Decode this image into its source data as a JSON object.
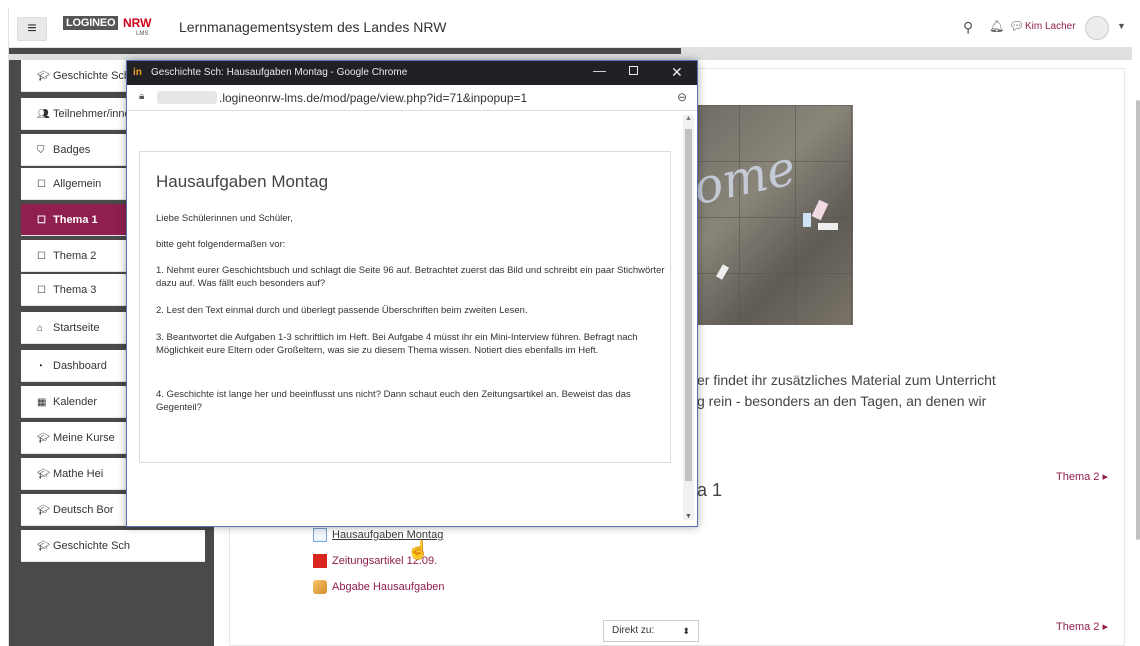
{
  "header": {
    "menu_icon": "menu-icon",
    "logo_part1": "LOGINEO",
    "logo_part2": "NRW",
    "logo_sub": "LMS",
    "site_title": "Lernmanagementsystem des Landes NRW",
    "user_name": "Kim Lacher",
    "accent_color": "#8e1f4e"
  },
  "sidebar": {
    "items": [
      {
        "label": "Geschichte Sch",
        "icon": "graduation-cap-icon"
      },
      {
        "label": "Teilnehmer/innen",
        "icon": "users-icon"
      },
      {
        "label": "Badges",
        "icon": "shield-icon"
      },
      {
        "label": "Allgemein",
        "icon": "folder-icon"
      },
      {
        "label": "Thema 1",
        "icon": "folder-icon",
        "active": true
      },
      {
        "label": "Thema 2",
        "icon": "folder-icon"
      },
      {
        "label": "Thema 3",
        "icon": "folder-icon"
      },
      {
        "label": "Startseite",
        "icon": "home-icon"
      },
      {
        "label": "Dashboard",
        "icon": "dashboard-icon"
      },
      {
        "label": "Kalender",
        "icon": "calendar-icon"
      },
      {
        "label": "Meine Kurse",
        "icon": "graduation-cap-icon"
      },
      {
        "label": "Mathe Hei",
        "icon": "graduation-cap-icon"
      },
      {
        "label": "Deutsch Bor",
        "icon": "graduation-cap-icon"
      },
      {
        "label": "Geschichte Sch",
        "icon": "graduation-cap-icon"
      }
    ]
  },
  "main": {
    "intro_line1": "er findet ihr zusätzliches Material zum Unterricht",
    "intro_line2": "g rein - besonders an den Tagen, an denen wir",
    "section_heading": "a 1",
    "nav_next_top": "Thema 2 ▸",
    "nav_next_bottom": "Thema 2 ▸",
    "activities": [
      {
        "label": "Hausaufgaben Montag",
        "icon": "page-icon"
      },
      {
        "label": "Zeitungsartikel 12.09.",
        "icon": "pdf-icon"
      },
      {
        "label": "Abgabe Hausaufgaben",
        "icon": "assignment-icon"
      }
    ],
    "jump_label": "Direkt zu:"
  },
  "popup": {
    "window_title": "Geschichte Sch: Hausaufgaben Montag - Google Chrome",
    "url": ".logineonrw-lms.de/mod/page/view.php?id=71&inpopup=1",
    "heading": "Hausaufgaben Montag",
    "paragraphs": [
      "Liebe Schülerinnen und Schüler,",
      "bitte geht folgendermaßen vor:",
      "1. Nehmt eurer Geschichtsbuch und schlagt die Seite 96 auf. Betrachtet zuerst das Bild und schreibt ein paar Stichwörter dazu auf. Was fällt euch besonders auf?",
      "2. Lest den Text einmal durch und überlegt passende Überschriften beim zweiten Lesen.",
      "3. Beantwortet die Aufgaben 1-3 schriftlich im Heft. Bei Aufgabe 4 müsst ihr ein Mini-Interview führen. Befragt nach Möglichkeit eure Eltern oder Großeltern, was sie zu diesem Thema wissen. Notiert dies ebenfalls im Heft.",
      "4. Geschichte ist lange her und beeinflusst uns nicht? Dann schaut euch den Zeitungsartikel an. Beweist das das Gegenteil?"
    ]
  }
}
